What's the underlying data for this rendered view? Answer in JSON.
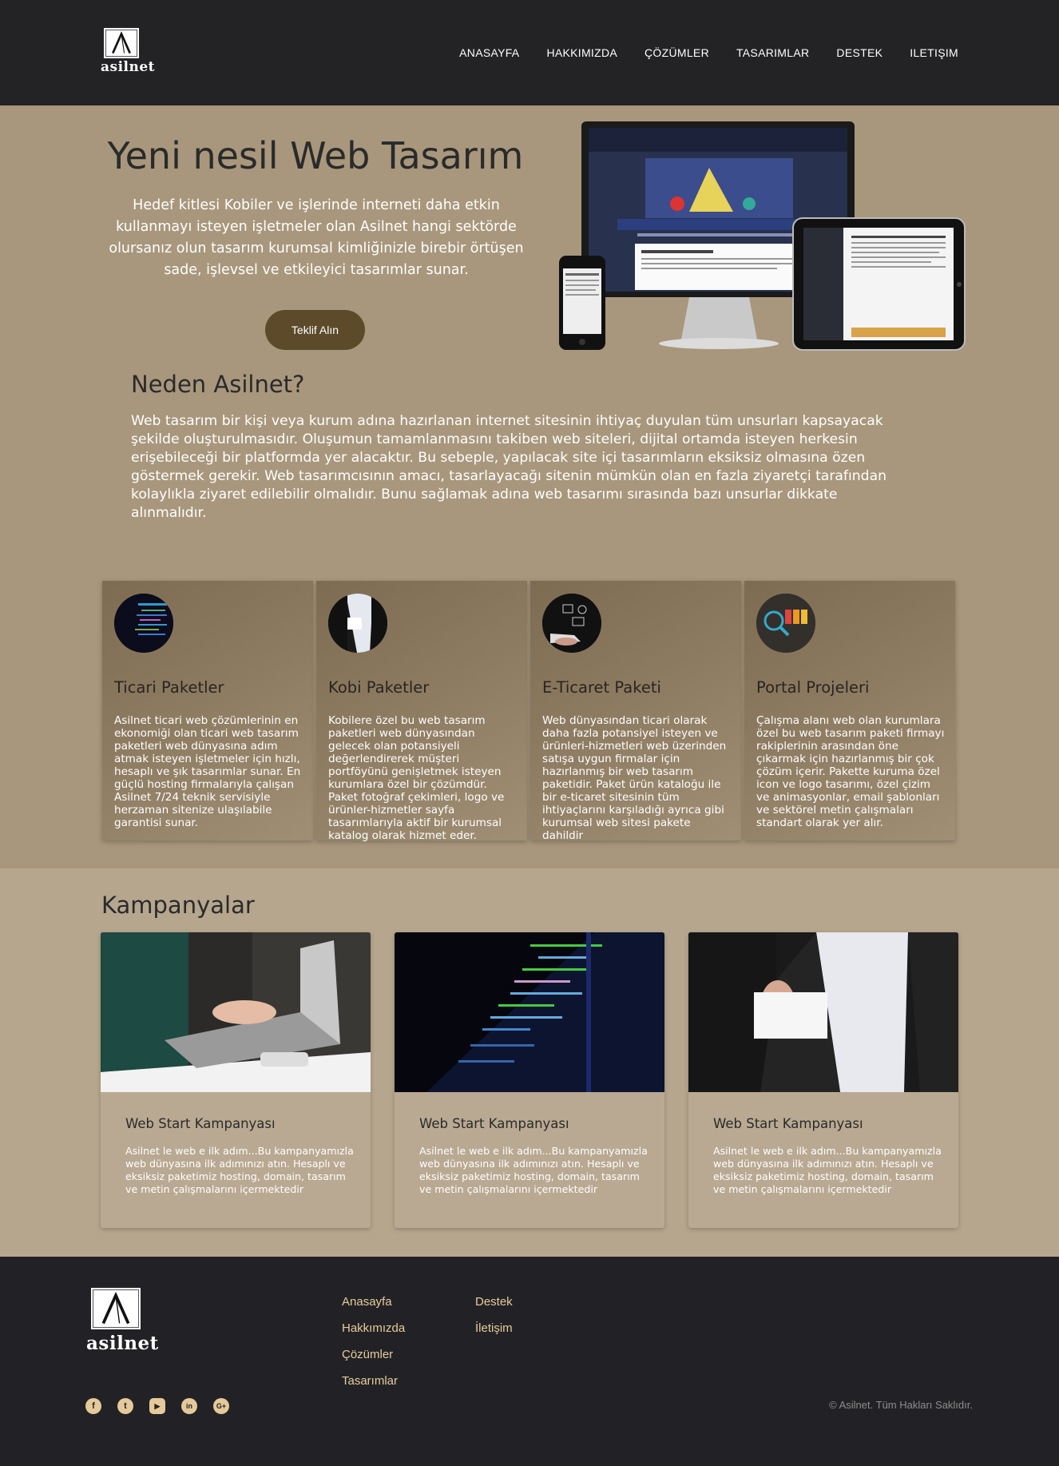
{
  "brand": {
    "name": "asilnet",
    "logo_letter": "A"
  },
  "nav": {
    "items": [
      {
        "label": "ANASAYFA"
      },
      {
        "label": "HAKKIMIZDA"
      },
      {
        "label": "ÇÖZÜMLER"
      },
      {
        "label": "TASARIMLAR"
      },
      {
        "label": "DESTEK"
      },
      {
        "label": "ILETIŞIM"
      }
    ]
  },
  "hero": {
    "title": "Yeni nesil Web Tasarım",
    "text": "Hedef kitlesi Kobiler ve işlerinde interneti daha etkin kullanmayı isteyen işletmeler olan Asilnet hangi sektörde olursanız olun tasarım kurumsal kimliğinizle birebir örtüşen sade, işlevsel ve etkileyici tasarımlar sunar.",
    "cta_label": "Teklif Alın"
  },
  "why": {
    "title": "Neden Asilnet?",
    "text": "Web tasarım bir kişi veya kurum adına hazırlanan internet sitesinin ihtiyaç duyulan tüm unsurları kapsayacak şekilde oluşturulmasıdır. Oluşumun tamamlanmasını takiben web siteleri, dijital ortamda isteyen herkesin erişebileceği bir platformda yer alacaktır. Bu sebeple, yapılacak site içi tasarımların eksiksiz olmasına özen göstermek gerekir. Web tasarımcısının amacı, tasarlayacağı sitenin mümkün olan en fazla ziyaretçi tarafından kolaylıkla ziyaret edilebilir olmalıdır. Bunu sağlamak adına web tasarımı sırasında bazı unsurlar dikkate alınmalıdır."
  },
  "features": [
    {
      "title": "Ticari Paketler",
      "text": "Asilnet ticari web çözümlerinin en ekonomiği olan ticari web tasarım paketleri web dünyasına adım atmak isteyen işletmeler için hızlı, hesaplı ve şık tasarımlar sunar. En güçlü hosting firmalarıyla çalışan Asilnet 7/24 teknik servisiyle herzaman sitenize ulaşılabile garantisi sunar."
    },
    {
      "title": "Kobi Paketler",
      "text": "Kobilere özel bu web tasarım paketleri web dünyasından gelecek olan potansiyeli değerlendirerek müşteri portföyünü genişletmek isteyen kurumlara özel bir çözümdür. Paket fotoğraf çekimleri, logo ve ürünler-hizmetler sayfa tasarımlarıyla aktif bir kurumsal katalog olarak hizmet eder."
    },
    {
      "title": "E-Ticaret Paketi",
      "text": "Web dünyasından ticari olarak daha fazla potansiyel isteyen ve ürünleri-hizmetleri web üzerinden satışa uygun firmalar için hazırlanmış bir web tasarım paketidir. Paket ürün kataloğu ile bir e-ticaret sitesinin tüm ihtiyaçlarını karşıladığı ayrıca gibi kurumsal web sitesi pakete dahildir"
    },
    {
      "title": "Portal Projeleri",
      "text": "Çalışma alanı web olan kurumlara özel bu web tasarım paketi firmayı rakiplerinin arasından öne çıkarmak için hazırlanmış bir çok çözüm içerir. Pakette kuruma özel icon ve logo tasarımı, özel çizim ve animasyonlar, email şablonları ve sektörel metin çalışmaları standart olarak yer alır."
    }
  ],
  "campaigns": {
    "title": "Kampanyalar",
    "items": [
      {
        "title": "Web Start Kampanyası",
        "text": "Asilnet le web e ilk adım...Bu kampanyamızla web dünyasına ilk adımınızı atın. Hesaplı ve eksiksiz paketimiz hosting, domain, tasarım ve metin çalışmalarını içermektedir"
      },
      {
        "title": "Web Start Kampanyası",
        "text": "Asilnet le web e ilk adım...Bu kampanyamızla web dünyasına ilk adımınızı atın. Hesaplı ve eksiksiz paketimiz hosting, domain, tasarım ve metin çalışmalarını içermektedir"
      },
      {
        "title": "Web Start Kampanyası",
        "text": "Asilnet le web e ilk adım...Bu kampanyamızla web dünyasına ilk adımınızı atın. Hesaplı ve eksiksiz paketimiz hosting, domain, tasarım ve metin çalışmalarını içermektedir"
      }
    ]
  },
  "footer": {
    "links_col1": [
      {
        "label": "Anasayfa"
      },
      {
        "label": "Hakkımızda"
      },
      {
        "label": "Çözümler"
      },
      {
        "label": "Tasarımlar"
      }
    ],
    "links_col2": [
      {
        "label": "Destek"
      },
      {
        "label": "İletişim"
      }
    ],
    "socials": [
      {
        "name": "facebook-icon",
        "glyph": "f"
      },
      {
        "name": "twitter-icon",
        "glyph": "t"
      },
      {
        "name": "youtube-icon",
        "glyph": "▶"
      },
      {
        "name": "linkedin-icon",
        "glyph": "in"
      },
      {
        "name": "google-plus-icon",
        "glyph": "G+"
      }
    ],
    "copyright": "© Asilnet. Tüm Hakları Saklıdır."
  },
  "colors": {
    "header_bg": "#232326",
    "hero_bg": "#a8977c",
    "section_bg": "#b6a68e",
    "cta_bg": "#5d4a2a",
    "footer_link": "#e7cc9c"
  }
}
